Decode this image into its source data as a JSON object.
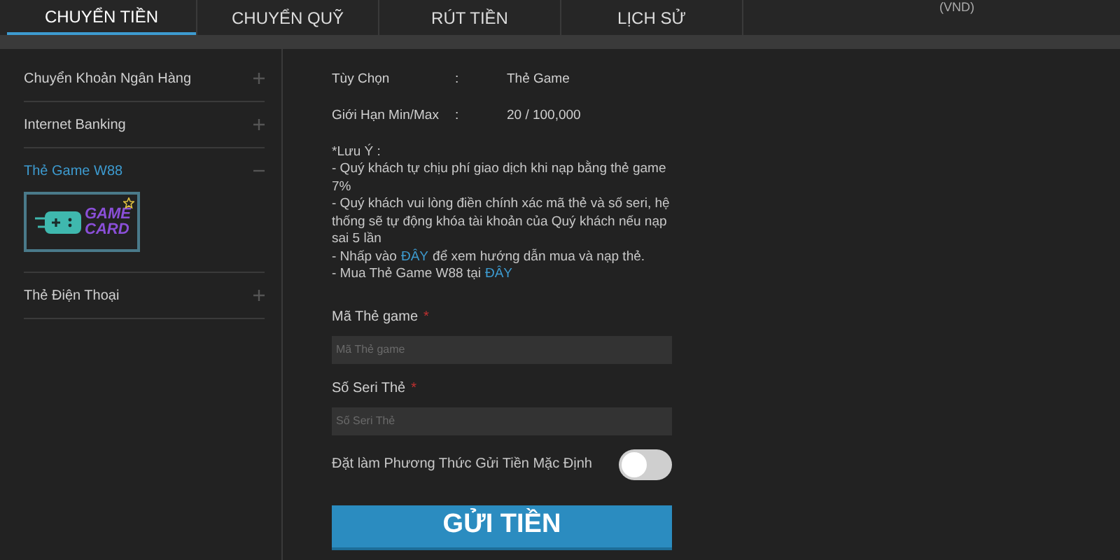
{
  "tabs": [
    {
      "label": "CHUYỂN TIỀN",
      "selected": true
    },
    {
      "label": "CHUYỂN QUỸ",
      "selected": false
    },
    {
      "label": "RÚT TIỀN",
      "selected": false
    },
    {
      "label": "LỊCH SỬ",
      "selected": false
    }
  ],
  "currency": "(VND)",
  "sidebar": {
    "items": [
      {
        "label": "Chuyển Khoản Ngân Hàng",
        "expanded": false
      },
      {
        "label": "Internet Banking",
        "expanded": false
      },
      {
        "label": "Thẻ Game W88",
        "expanded": true,
        "card": {
          "line_1": "GAME",
          "line_2": "CARD"
        }
      },
      {
        "label": "Thẻ Điện Thoại",
        "expanded": false
      }
    ]
  },
  "info": [
    {
      "label": "Tùy Chọn",
      "separator": ":",
      "value": "Thẻ Game"
    },
    {
      "label": "Giới Hạn Min/Max",
      "separator": ":",
      "value": "20 / 100,000"
    }
  ],
  "notes": {
    "title": "*Lưu Ý :",
    "lines": [
      {
        "text": "- Quý khách tự chịu phí giao dịch khi nạp bằng thẻ game 7%"
      },
      {
        "text": "- Quý khách vui lòng điền chính xác mã thẻ và số seri, hệ thống sẽ tự động khóa tài khoản của Quý khách nếu nạp sai 5 lần"
      },
      {
        "text": "- Nhấp vào",
        "link": "ĐÂY",
        "after": "để xem hướng dẫn mua và nạp thẻ."
      },
      {
        "text": "- Mua Thẻ Game W88 tại",
        "link": "ĐÂY"
      }
    ]
  },
  "fields": [
    {
      "label": "Mã Thẻ game",
      "required_mark": "*",
      "placeholder": "Mã Thẻ game"
    },
    {
      "label": "Số Seri Thẻ",
      "required_mark": "*",
      "placeholder": "Số Seri Thẻ"
    }
  ],
  "default_toggle": {
    "label": "Đặt làm Phương Thức Gửi Tiền Mặc Định",
    "on": false
  },
  "submit": "GỬI TIỀN"
}
